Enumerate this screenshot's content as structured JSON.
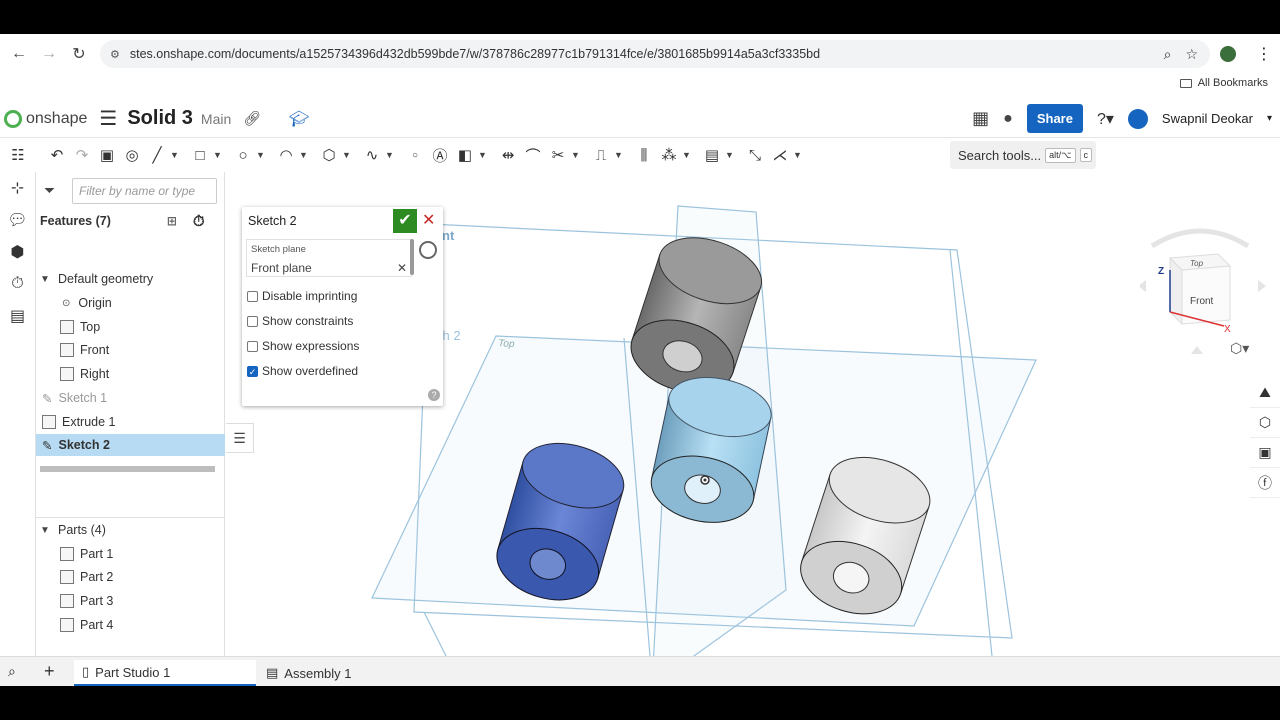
{
  "browser": {
    "url": "stes.onshape.com/documents/a1525734396d432db599bde7/w/378786c28977c1b791314fce/e/3801685b9914a5a3cf3335bd",
    "bookmarks_label": "All Bookmarks"
  },
  "header": {
    "logo_text": "onshape",
    "doc_title": "Solid 3",
    "branch": "Main",
    "share_label": "Share",
    "user_name": "Swapnil Deokar"
  },
  "toolbar": {
    "search_label": "Search tools...",
    "shortcut_1": "alt/⌥",
    "shortcut_2": "c"
  },
  "feature_tree": {
    "filter_placeholder": "Filter by name or type",
    "features_header": "Features (7)",
    "default_geometry": "Default geometry",
    "items": [
      "Origin",
      "Top",
      "Front",
      "Right"
    ],
    "sketch1": "Sketch 1",
    "extrude1": "Extrude 1",
    "sketch2": "Sketch 2",
    "parts_header": "Parts (4)",
    "parts": [
      "Part 1",
      "Part 2",
      "Part 3",
      "Part 4"
    ]
  },
  "sketch_dialog": {
    "title": "Sketch 2",
    "plane_caption": "Sketch plane",
    "plane_value": "Front plane",
    "options": [
      {
        "label": "Disable imprinting",
        "checked": false
      },
      {
        "label": "Show constraints",
        "checked": false
      },
      {
        "label": "Show expressions",
        "checked": false
      },
      {
        "label": "Show overdefined",
        "checked": true
      }
    ]
  },
  "viewport": {
    "plane_label_top": "Top",
    "plane_label_front": "nt",
    "sketch_label": "ch 2"
  },
  "viewcube": {
    "top": "Top",
    "front": "Front",
    "z_axis": "Z",
    "x_axis": "X"
  },
  "tabs": {
    "part_studio": "Part Studio 1",
    "assembly": "Assembly 1"
  },
  "colors": {
    "accent": "#1565c0",
    "selected_row": "#b7dbf3",
    "confirm": "#2e8b22",
    "cancel": "#c62828"
  }
}
